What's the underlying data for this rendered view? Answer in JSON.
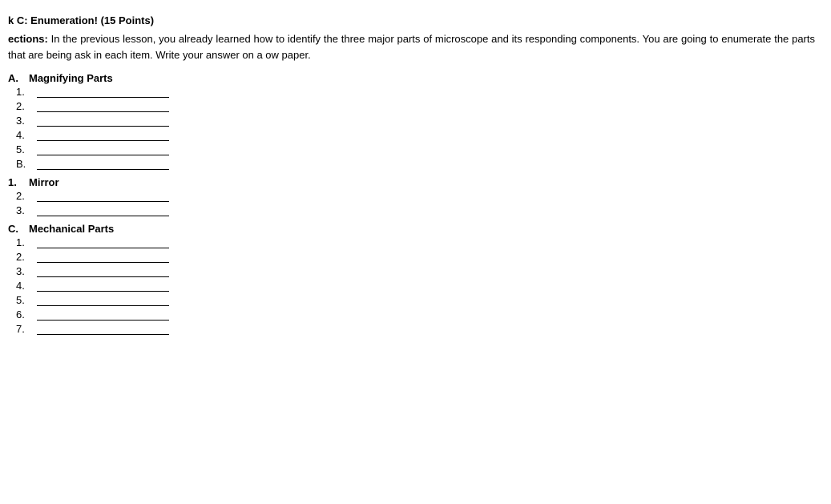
{
  "task": {
    "title": "k C: Enumeration! (15 Points)",
    "instructions_label": "ections:",
    "instructions_text": "In the previous lesson, you already learned how to identify the three major parts of microscope and its responding components. You are going to enumerate the parts that are being ask in each item. Write your answer on a ow paper.",
    "sections": [
      {
        "letter": "A.",
        "name": "Magnifying Parts",
        "items": [
          {
            "num": "1.",
            "bold": false
          },
          {
            "num": "2.",
            "bold": false
          },
          {
            "num": "3.",
            "bold": false
          },
          {
            "num": "4.",
            "bold": false
          },
          {
            "num": "5.",
            "bold": false
          },
          {
            "num": "B.",
            "bold": false
          }
        ]
      },
      {
        "letter": "1.",
        "name": "Mirror",
        "items": [
          {
            "num": "2.",
            "bold": false
          },
          {
            "num": "3.",
            "bold": false
          }
        ]
      },
      {
        "letter": "C.",
        "name": "Mechanical Parts",
        "items": [
          {
            "num": "1.",
            "bold": false
          },
          {
            "num": "2.",
            "bold": false
          },
          {
            "num": "3.",
            "bold": false
          },
          {
            "num": "4.",
            "bold": false
          },
          {
            "num": "5.",
            "bold": false
          },
          {
            "num": "6.",
            "bold": false
          },
          {
            "num": "7.",
            "bold": false
          }
        ]
      }
    ]
  }
}
